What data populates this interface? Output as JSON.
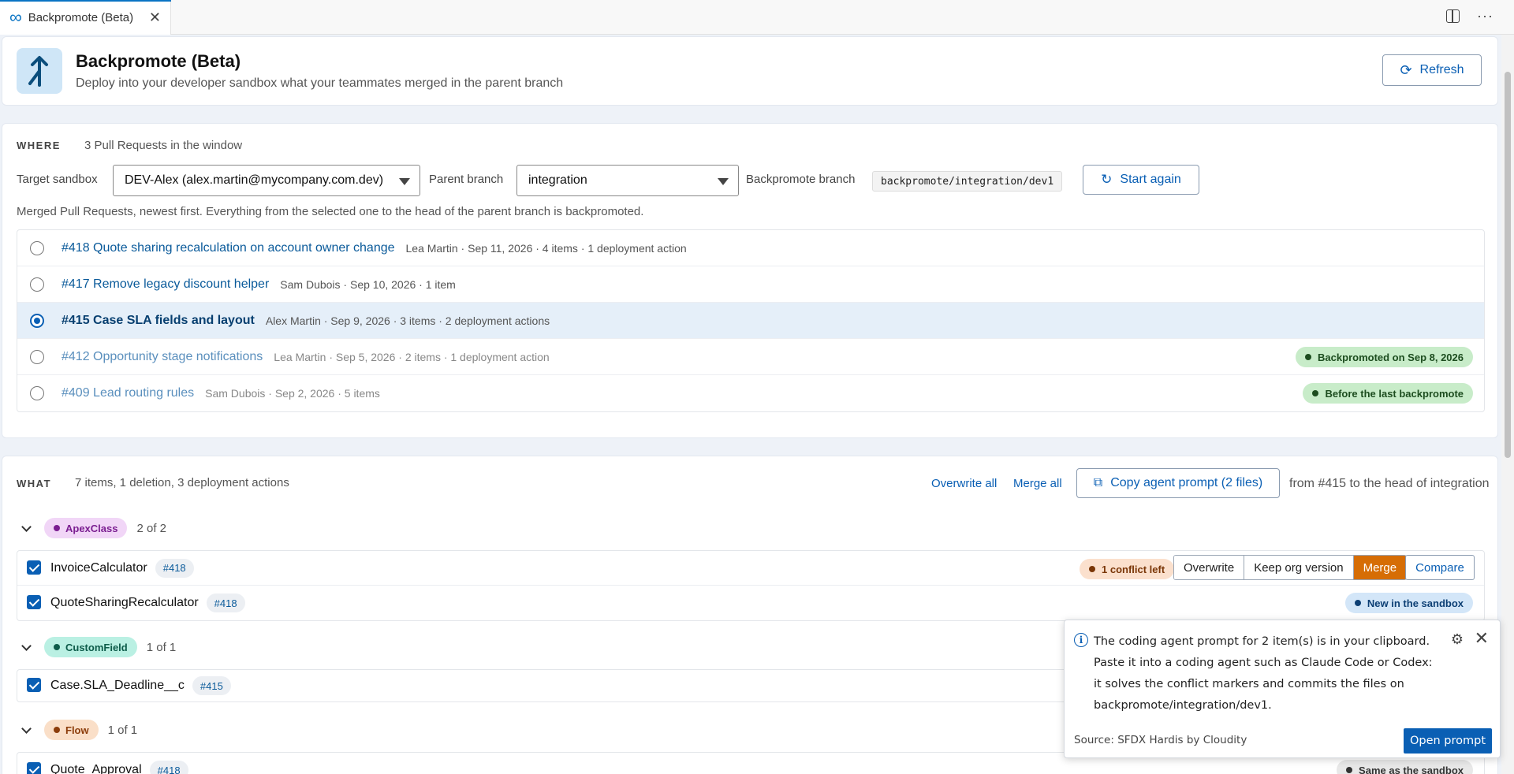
{
  "tab": {
    "title": "Backpromote (Beta)"
  },
  "header": {
    "title": "Backpromote (Beta)",
    "subtitle": "Deploy into your developer sandbox what your teammates merged in the parent branch",
    "refresh_label": "Refresh"
  },
  "where": {
    "label": "WHERE",
    "summary": "3 Pull Requests in the window",
    "target_sandbox_label": "Target sandbox",
    "target_sandbox_value": "DEV-Alex (alex.martin@mycompany.com.dev)",
    "parent_branch_label": "Parent branch",
    "parent_branch_value": "integration",
    "backpromote_branch_label": "Backpromote branch",
    "backpromote_branch_value": "backpromote/integration/dev1",
    "start_again_label": "Start again",
    "hint": "Merged Pull Requests, newest first. Everything from the selected one to the head of the parent branch is backpromoted.",
    "pull_requests": [
      {
        "title": "#418 Quote sharing recalculation on account owner change",
        "meta": "Lea Martin · Sep 11, 2026 · 4 items · 1 deployment action",
        "selected": false,
        "badge": ""
      },
      {
        "title": "#417 Remove legacy discount helper",
        "meta": "Sam Dubois · Sep 10, 2026 · 1 item",
        "selected": false,
        "badge": ""
      },
      {
        "title": "#415 Case SLA fields and layout",
        "meta": "Alex Martin · Sep 9, 2026 · 3 items · 2 deployment actions",
        "selected": true,
        "badge": ""
      },
      {
        "title": "#412 Opportunity stage notifications",
        "meta": "Lea Martin · Sep 5, 2026 · 2 items · 1 deployment action",
        "selected": false,
        "badge": "Backpromoted on Sep 8, 2026"
      },
      {
        "title": "#409 Lead routing rules",
        "meta": "Sam Dubois · Sep 2, 2026 · 5 items",
        "selected": false,
        "badge": "Before the last backpromote"
      }
    ]
  },
  "what": {
    "label": "WHAT",
    "summary": "7 items, 1 deletion, 3 deployment actions",
    "overwrite_all_label": "Overwrite all",
    "merge_all_label": "Merge all",
    "copy_prompt_label": "Copy agent prompt (2 files)",
    "range_text": "from #415 to the head of integration",
    "groups": [
      {
        "type": "ApexClass",
        "count": "2 of 2",
        "items": [
          {
            "name": "InvoiceCalculator",
            "pr": "#418",
            "status": "1 conflict left",
            "actions": [
              "Overwrite",
              "Keep org version",
              "Merge"
            ],
            "active_action": "Merge",
            "compare_label": "Compare"
          },
          {
            "name": "QuoteSharingRecalculator",
            "pr": "#418",
            "status": "New in the sandbox"
          }
        ]
      },
      {
        "type": "CustomField",
        "count": "1 of 1",
        "items": [
          {
            "name": "Case.SLA_Deadline__c",
            "pr": "#415"
          }
        ]
      },
      {
        "type": "Flow",
        "count": "1 of 1",
        "items": [
          {
            "name": "Quote_Approval",
            "pr": "#418",
            "status": "Same as the sandbox"
          }
        ]
      }
    ]
  },
  "toast": {
    "message": "The coding agent prompt for 2 item(s) is in your clipboard. Paste it into a coding agent such as Claude Code or Codex: it solves the conflict markers and commits the files on backpromote/integration/dev1.",
    "source": "Source: SFDX Hardis by Cloudity",
    "button_label": "Open prompt"
  },
  "icons": {
    "tab": "infinity-icon",
    "close": "close-icon",
    "split": "split-editor-icon",
    "more": "more-icon",
    "logo": "merge-arrow-icon",
    "refresh": "refresh-icon",
    "restart": "restart-icon",
    "copy": "copy-icon",
    "info": "info-icon",
    "gear": "gear-icon"
  },
  "colors": {
    "accent": "#0a5fb4",
    "merge_active": "#d66d05",
    "selected_row": "#e5eff9"
  }
}
